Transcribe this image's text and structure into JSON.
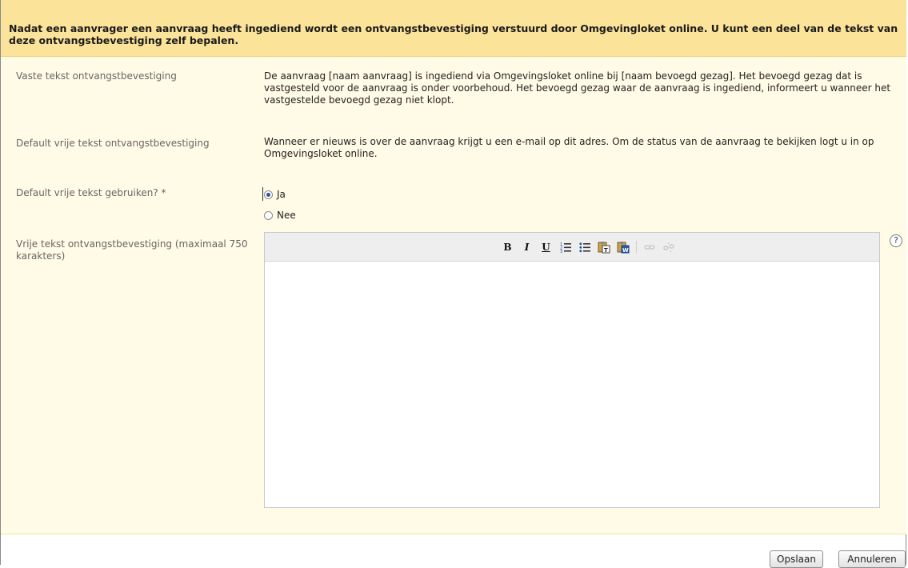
{
  "header": {
    "intro": "Nadat een aanvrager een aanvraag heeft ingediend wordt een ontvangstbevestiging verstuurd door Omgevingloket online. U kunt een deel van de tekst van deze ontvangstbevestiging zelf bepalen."
  },
  "rows": {
    "fixed": {
      "label": "Vaste tekst ontvangstbevestiging",
      "value": "De aanvraag [naam aanvraag] is ingediend via Omgevingsloket online bij [naam bevoegd gezag]. Het bevoegd gezag dat is vastgesteld voor de aanvraag is onder voorbehoud. Het bevoegd gezag waar de aanvraag is ingediend, informeert u wanneer het vastgestelde bevoegd gezag niet klopt."
    },
    "default_text": {
      "label": "Default vrije tekst ontvangstbevestiging",
      "value": "Wanneer er nieuws is over de aanvraag krijgt u een e-mail op dit adres. Om de status van de aanvraag te bekijken logt u in op Omgevingsloket online."
    },
    "use_default": {
      "label": "Default vrije tekst gebruiken? *",
      "options": [
        {
          "label": "Ja",
          "checked": true
        },
        {
          "label": "Nee",
          "checked": false
        }
      ]
    },
    "free_text": {
      "label": "Vrije tekst ontvangstbevestiging (maximaal 750 karakters)",
      "value": ""
    }
  },
  "toolbar": {
    "bold": "B",
    "italic": "I",
    "underline": "U",
    "icons": [
      "bold-icon",
      "italic-icon",
      "underline-icon",
      "numbered-list-icon",
      "bullet-list-icon",
      "paste-text-icon",
      "paste-word-icon",
      "link-icon",
      "unlink-icon"
    ]
  },
  "help": {
    "symbol": "?"
  },
  "buttons": {
    "save": "Opslaan",
    "cancel": "Annuleren"
  },
  "colors": {
    "header_bg": "#fbe39a",
    "panel_bg": "#fffbe6",
    "radio_accent": "#2a52a8"
  }
}
